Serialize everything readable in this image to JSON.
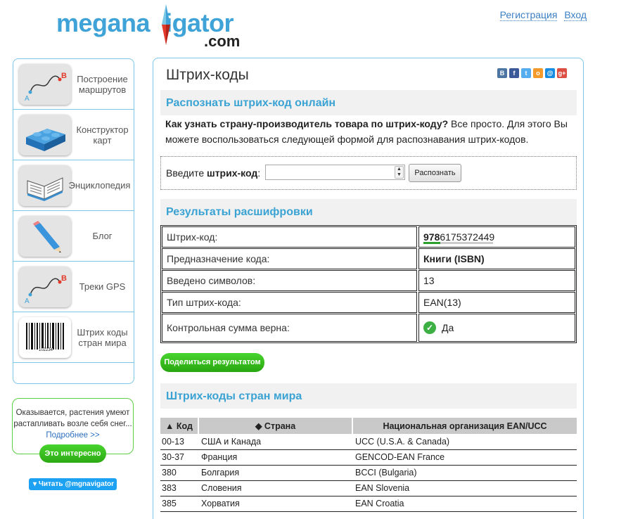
{
  "header": {
    "logo_part1": "megana",
    "logo_part2": "igator",
    "logo_com": ".com",
    "register": "Регистрация",
    "login": "Вход"
  },
  "sidebar": {
    "items": [
      {
        "label": "Построение маршрутов",
        "icon": "route-icon"
      },
      {
        "label": "Конструктор карт",
        "icon": "lego-brick-icon"
      },
      {
        "label": "Энциклопедия",
        "icon": "book-icon"
      },
      {
        "label": "Блог",
        "icon": "pencil-icon"
      },
      {
        "label": "Треки GPS",
        "icon": "gps-track-icon"
      },
      {
        "label": "Штрих коды стран мира",
        "icon": "barcode-icon"
      }
    ],
    "barcode_number": "102234",
    "promo_text": "Оказывается, растения умеют растапливать возле себя снег...",
    "promo_link": "Подробнее >>",
    "promo_button": "Это интересно",
    "twitter": "Читать @mgnavigator"
  },
  "main": {
    "title": "Штрих-коды",
    "share_icons": [
      "В",
      "f",
      "t",
      "о",
      "@",
      "g+"
    ],
    "recognize_title": "Распознать штрих-код онлайн",
    "intro_bold": "Как узнать страну-производитель товара по штрих-коду?",
    "intro_rest": " Все просто. Для этого Вы можете воспользоваться следующей формой для распознавания штрих-кодов.",
    "form_label_pre": "Введите ",
    "form_label_bold": "штрих-код",
    "form_label_post": ":",
    "input_value": "",
    "recognize_button": "Распознать",
    "results_title": "Результаты расшифровки",
    "results": [
      {
        "label": "Штрих-код:",
        "value_bold": "978",
        "value": "6175372449"
      },
      {
        "label": "Предназначение кода:",
        "value_bold": "Книги (ISBN)",
        "value": ""
      },
      {
        "label": "Введено символов:",
        "value_bold": "",
        "value": "13"
      },
      {
        "label": "Тип штрих-кода:",
        "value_bold": "",
        "value": "EAN(13)"
      },
      {
        "label": "Контрольная сумма верна:",
        "value_bold": "",
        "value": "Да"
      }
    ],
    "share_result": "Поделиться результатом",
    "countries_title": "Штрих-коды стран мира",
    "table_headers": [
      "▲ Код",
      "◆ Страна",
      "Национальная организация EAN/UCC"
    ],
    "table_rows": [
      [
        "00-13",
        "США и Канада",
        "UCC (U.S.A. & Canada)"
      ],
      [
        "30-37",
        "Франция",
        "GENCOD-EAN France"
      ],
      [
        "380",
        "Болгария",
        "BCCI (Bulgaria)"
      ],
      [
        "383",
        "Словения",
        "EAN Slovenia"
      ],
      [
        "385",
        "Хорватия",
        "EAN Croatia"
      ]
    ]
  }
}
